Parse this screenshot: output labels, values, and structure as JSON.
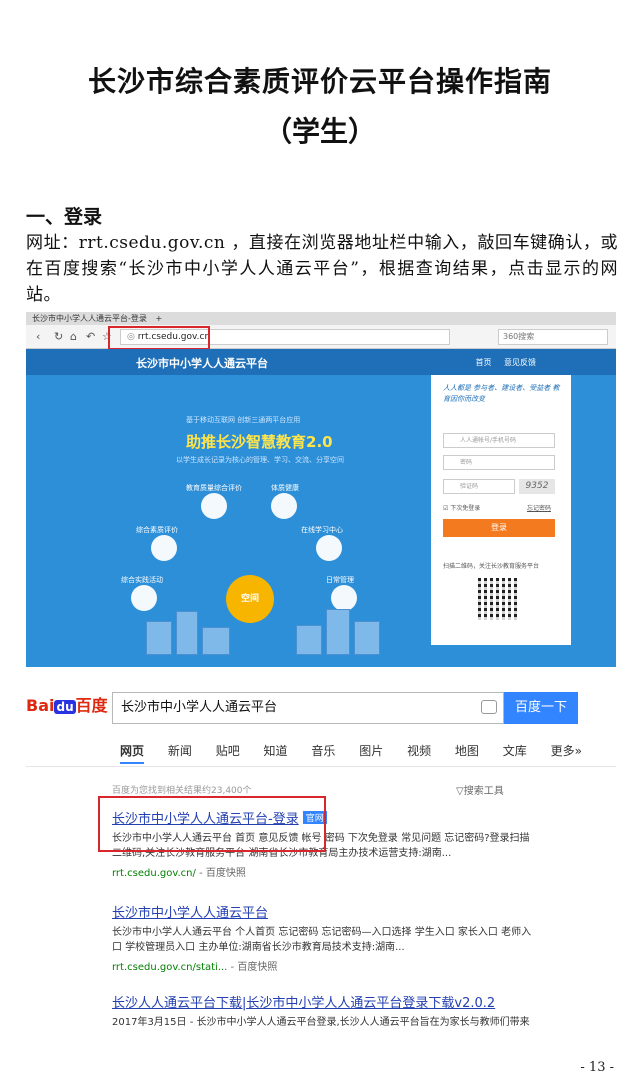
{
  "doc": {
    "title": "长沙市综合素质评价云平台操作指南",
    "subtitle": "（学生）",
    "section_heading": "一、登录",
    "paragraph": "网址：rrt.csedu.gov.cn ，直接在浏览器地址栏中输入，敲回车键确认，或在百度搜索“长沙市中小学人人通云平台”，根据查询结果，点击显示的网站。",
    "page_number": "- 13 -"
  },
  "browser": {
    "tab_title": "长沙市中小学人人通云平台-登录",
    "new_tab": "+",
    "url": "rrt.csedu.gov.cn",
    "search_placeholder": "360搜索"
  },
  "site": {
    "name": "长沙市中小学人人通云平台",
    "nav": [
      "首页",
      "意见反馈"
    ],
    "hero_small1": "基于移动互联网  创新三通两平台应用",
    "hero_big": "助推长沙智慧教育2.0",
    "hero_small2": "以学生成长记录为核心的管理、学习、交流、分享空间",
    "bubbles": [
      "教育质量综合评价",
      "体质健康",
      "综合素质评价",
      "在线学习中心",
      "综合实践活动",
      "日常管理"
    ],
    "center": "空间",
    "login": {
      "slogan": "人人都是 参与者、建设者、受益者 教育因你而改变",
      "user_placeholder": "人人通帐号/手机号码",
      "pwd_placeholder": "密码",
      "captcha_placeholder": "验证码",
      "captcha": "9352",
      "remember": "下次免登录",
      "forgot": "忘记密码",
      "button": "登录",
      "qr_caption": "扫描二维码，关注长沙教育服务平台"
    }
  },
  "baidu": {
    "logo_bai": "Bai",
    "logo_du": "du",
    "logo_zh": "百度",
    "query": "长沙市中小学人人通云平台",
    "button": "百度一下",
    "tabs": [
      "网页",
      "新闻",
      "贴吧",
      "知道",
      "音乐",
      "图片",
      "视频",
      "地图",
      "文库",
      "更多»"
    ],
    "count": "百度为您找到相关结果约23,400个",
    "tools": "搜索工具",
    "results": [
      {
        "title": "长沙市中小学人人通云平台-登录",
        "badge": "官网",
        "desc": "长沙市中小学人人通云平台 首页 意见反馈 帐号 密码 下次免登录 常见问题 忘记密码?登录扫描二维码,关注长沙教育服务平台 湖南省长沙市教育局主办技术运营支持:湖南...",
        "url": "rrt.csedu.gov.cn/",
        "snapshot": "- 百度快照"
      },
      {
        "title": "长沙市中小学人人通云平台",
        "desc": "长沙市中小学人人通云平台 个人首页 忘记密码 忘记密码—入口选择 学生入口 家长入口 老师入口 学校管理员入口 主办单位:湖南省长沙市教育局技术支持:湖南...",
        "url": "rrt.csedu.gov.cn/stati...",
        "snapshot": "- 百度快照"
      },
      {
        "title": "长沙人人通云平台下载|长沙市中小学人人通云平台登录下载v2.0.2",
        "desc": "2017年3月15日 - 长沙市中小学人人通云平台登录,长沙人人通云平台旨在为家长与教师们带来"
      }
    ]
  }
}
